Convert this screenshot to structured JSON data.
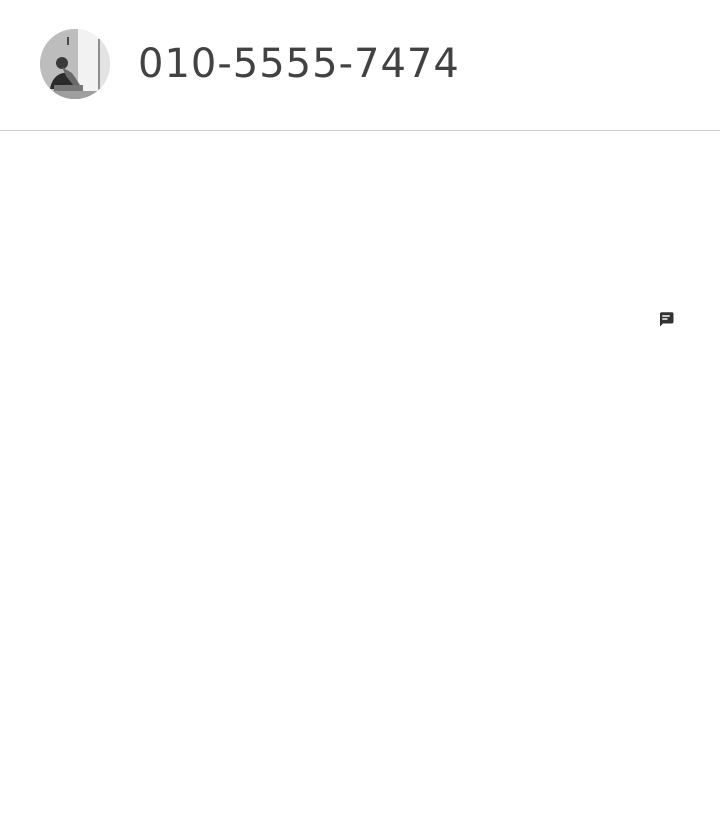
{
  "contact": {
    "phone_number": "010-5555-7474",
    "avatar": "contact-photo"
  },
  "actions": {
    "message_icon": "message-icon"
  },
  "colors": {
    "text": "#424242",
    "divider": "#cfcfcf",
    "icon": "#333333",
    "background": "#ffffff"
  }
}
